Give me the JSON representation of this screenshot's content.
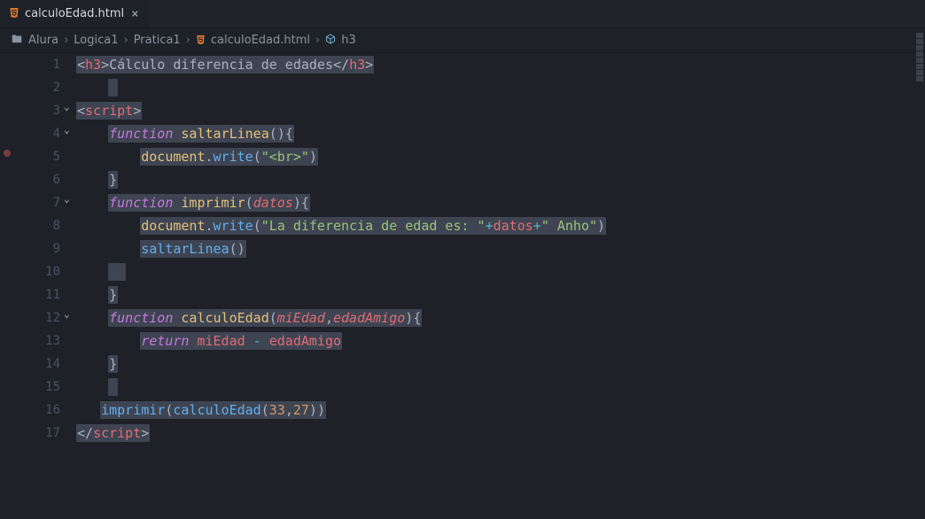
{
  "tab": {
    "label": "calculoEdad.html",
    "close": "×"
  },
  "breadcrumbs": {
    "s0": "Alura",
    "s1": "Logica1",
    "s2": "Pratica1",
    "s3": "calculoEdad.html",
    "s4": "h3",
    "sep": "›"
  },
  "fold": {
    "v3": "⌄",
    "v4": "⌄",
    "v7": "⌄",
    "v12": "⌄"
  },
  "ln": {
    "l1": "1",
    "l2": "2",
    "l3": "3",
    "l4": "4",
    "l5": "5",
    "l6": "6",
    "l7": "7",
    "l8": "8",
    "l9": "9",
    "l10": "10",
    "l11": "11",
    "l12": "12",
    "l13": "13",
    "l14": "14",
    "l15": "15",
    "l16": "16",
    "l17": "17"
  },
  "code": {
    "t_lt": "<",
    "t_gt": ">",
    "t_slash": "/",
    "t_h3": "h3",
    "t_script": "script",
    "h3text": "Cálculo diferencia de edades",
    "kw_function": "function",
    "fn_saltar": "saltarLinea",
    "fn_imprimir": "imprimir",
    "fn_calculo": "calculoEdad",
    "par_open": "(",
    "par_close": ")",
    "brace_open": "{",
    "brace_close": "}",
    "obj_document": "document",
    "dot": ".",
    "call_write": "write",
    "str_br": "\"<br>\"",
    "param_datos": "datos",
    "str_pre": "\"La diferencia de edad es: \"",
    "plus": "+",
    "str_anho": "\" Anho\"",
    "call_saltar": "saltarLinea",
    "param_miEdad": "miEdad",
    "comma": ",",
    "param_edadAmigo": "edadAmigo",
    "kw_return": "return",
    "var_miEdad": "miEdad",
    "minus": " - ",
    "var_edadAmigo": "edadAmigo",
    "num33": "33",
    "num27": "27",
    "call_imprimir": "imprimir",
    "call_calculo": "calculoEdad"
  },
  "indent": {
    "i1": "    ",
    "i2": "        "
  }
}
